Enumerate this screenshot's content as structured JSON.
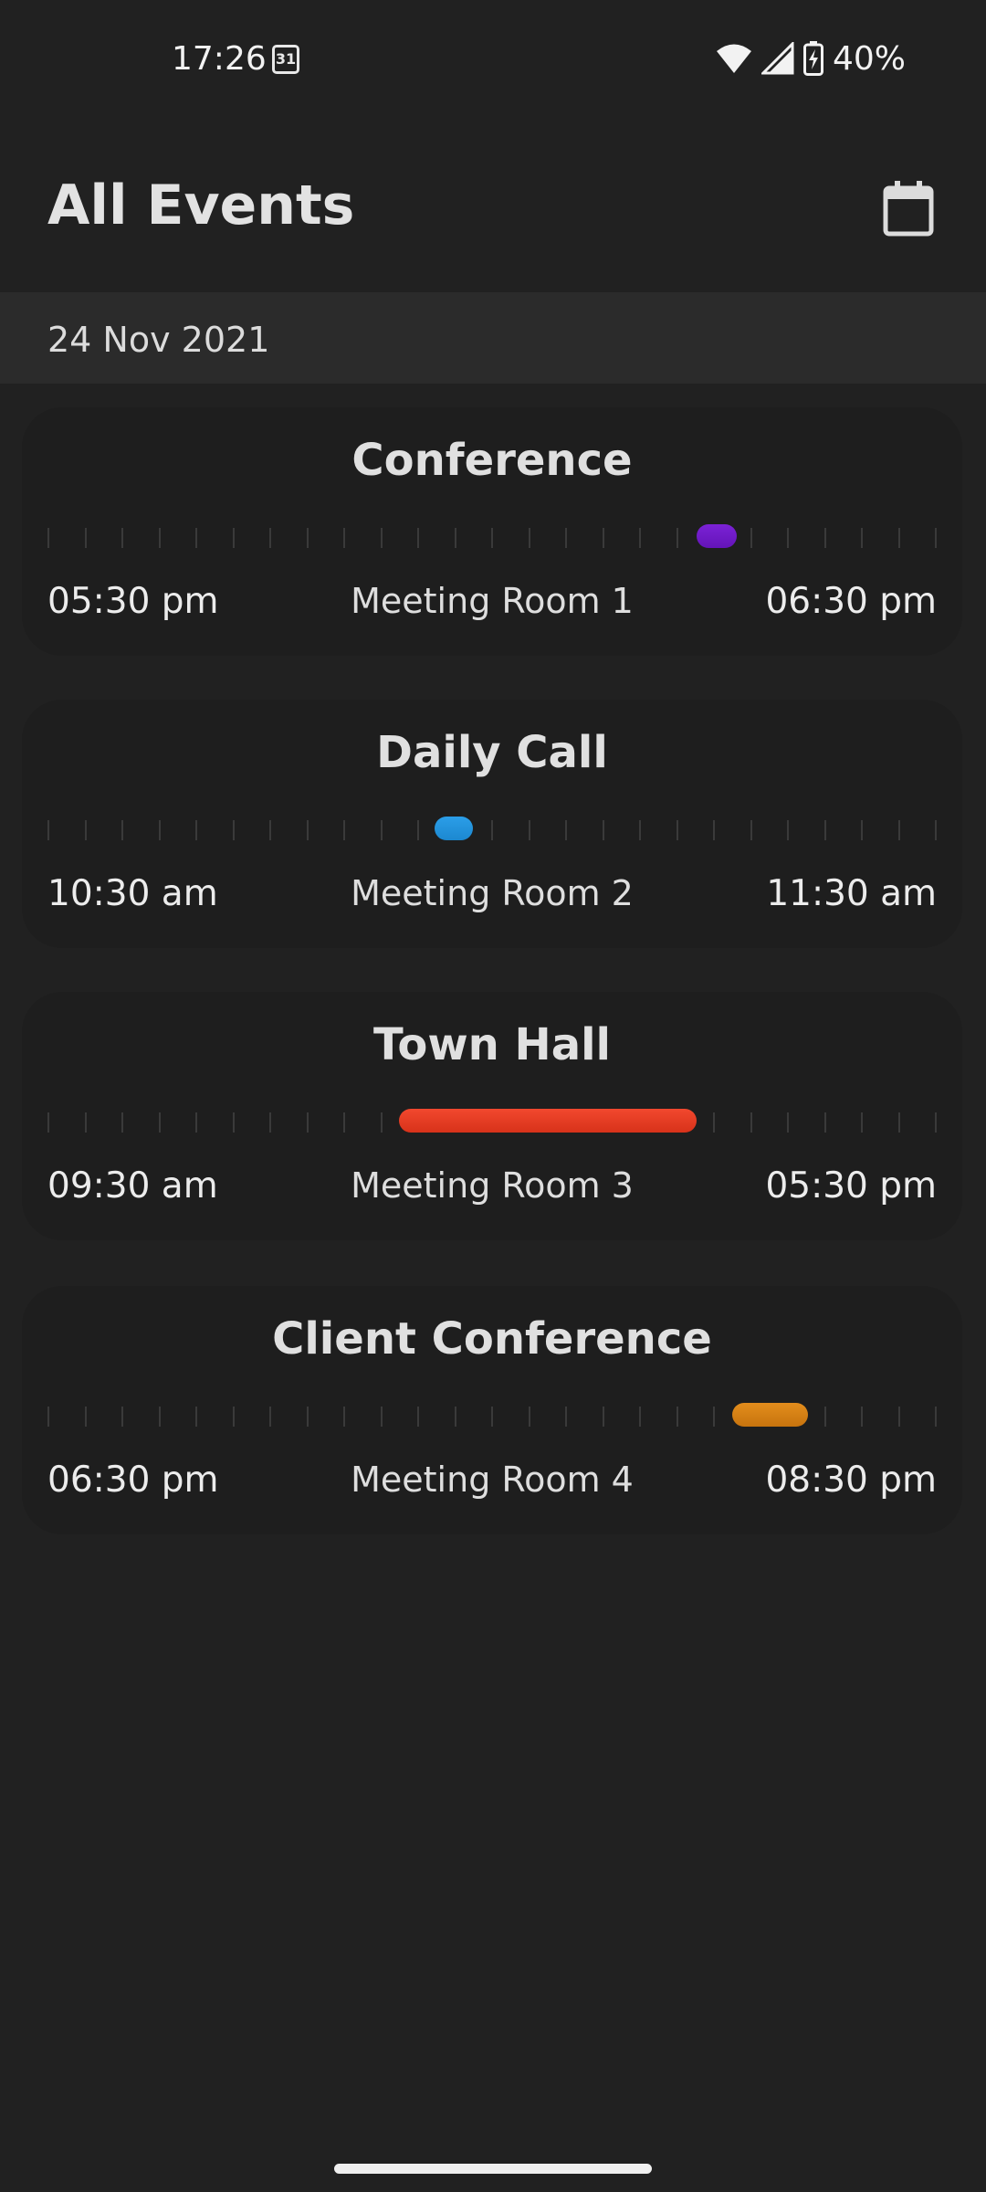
{
  "status_bar": {
    "time": "17:26",
    "calendar_day": "31",
    "battery": "40%"
  },
  "header": {
    "title": "All Events",
    "calendar_icon": "calendar-icon"
  },
  "date_header": "24 Nov 2021",
  "events": [
    {
      "title": "Conference",
      "start": "05:30 pm",
      "end": "06:30 pm",
      "room": "Meeting Room 1",
      "bar_start_fraction": 0.73,
      "bar_end_fraction": 0.775,
      "color": "#7b22d6",
      "color2": "#6414b8"
    },
    {
      "title": "Daily Call",
      "start": "10:30 am",
      "end": "11:30 am",
      "room": "Meeting Room 2",
      "bar_start_fraction": 0.435,
      "bar_end_fraction": 0.478,
      "color": "#2b9ee8",
      "color2": "#1c88d0"
    },
    {
      "title": "Town Hall",
      "start": "09:30 am",
      "end": "05:30 pm",
      "room": "Meeting Room 3",
      "bar_start_fraction": 0.395,
      "bar_end_fraction": 0.73,
      "color": "#f2482e",
      "color2": "#d8321a"
    },
    {
      "title": "Client Conference",
      "start": "06:30 pm",
      "end": "08:30 pm",
      "room": "Meeting Room 4",
      "bar_start_fraction": 0.77,
      "bar_end_fraction": 0.855,
      "color": "#e38d1c",
      "color2": "#c7740e"
    }
  ]
}
